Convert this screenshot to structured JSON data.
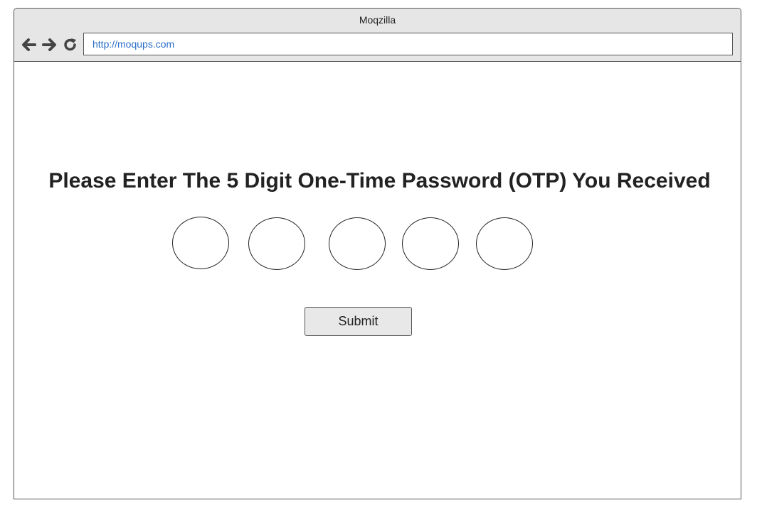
{
  "browser": {
    "title": "Moqzilla",
    "url": "http://moqups.com",
    "nav_icons": [
      "back-arrow-icon",
      "forward-arrow-icon",
      "refresh-icon"
    ]
  },
  "page": {
    "heading": "Please Enter The 5 Digit One-Time Password (OTP) You Received",
    "otp_fields": [
      "",
      "",
      "",
      "",
      ""
    ],
    "submit_label": "Submit"
  }
}
